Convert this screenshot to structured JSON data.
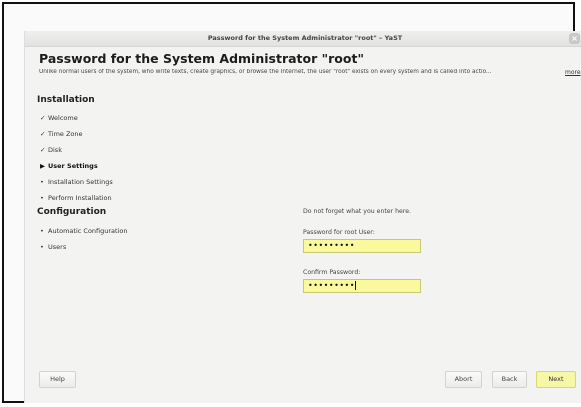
{
  "window": {
    "title": "Password for the System Administrator \"root\" – YaST",
    "close_glyph": "×"
  },
  "header": {
    "title": "Password for the System Administrator \"root\"",
    "description": "Unlike normal users of the system, who write texts, create graphics, or browse the Internet, the user \"root\" exists on every system and is called into actio...",
    "more_link": "more"
  },
  "sidebar": {
    "installation_title": "Installation",
    "installation_steps": [
      {
        "label": "Welcome",
        "mark": "✓",
        "status": "done"
      },
      {
        "label": "Time Zone",
        "mark": "✓",
        "status": "done"
      },
      {
        "label": "Disk",
        "mark": "✓",
        "status": "done"
      },
      {
        "label": "User Settings",
        "mark": "▶",
        "status": "current"
      },
      {
        "label": "Installation Settings",
        "mark": "•",
        "status": "pending"
      },
      {
        "label": "Perform Installation",
        "mark": "•",
        "status": "pending"
      }
    ],
    "configuration_title": "Configuration",
    "configuration_steps": [
      {
        "label": "Automatic Configuration",
        "mark": "•",
        "status": "pending"
      },
      {
        "label": "Users",
        "mark": "•",
        "status": "pending"
      }
    ]
  },
  "form": {
    "hint": "Do not forget what you enter here.",
    "password_label": "Password for root User:",
    "password_value": "•••••••••",
    "confirm_label": "Confirm Password:",
    "confirm_value": "•••••••••"
  },
  "buttons": {
    "help": "Help",
    "abort": "Abort",
    "back": "Back",
    "next": "Next"
  },
  "colors": {
    "field_background": "#fafa9c",
    "next_button": "#f7f7a8",
    "window_background": "#f3f3f2"
  }
}
